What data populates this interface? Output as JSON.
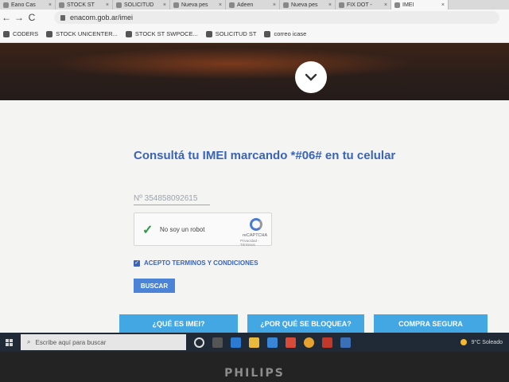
{
  "browser": {
    "tabs": [
      {
        "label": "Eano Cas",
        "active": false
      },
      {
        "label": "STOCK ST",
        "active": false
      },
      {
        "label": "SOLICITUD",
        "active": false
      },
      {
        "label": "Nueva pes",
        "active": false
      },
      {
        "label": "Adeen",
        "active": false
      },
      {
        "label": "Nueva pes",
        "active": false
      },
      {
        "label": "FIX DOT -",
        "active": false
      },
      {
        "label": "IMEI",
        "active": true
      }
    ],
    "url": "enacom.gob.ar/imei",
    "bookmarks": [
      {
        "label": "CODERS"
      },
      {
        "label": "STOCK UNICENTER..."
      },
      {
        "label": "STOCK ST SWPOCE..."
      },
      {
        "label": "SOLICITUD ST"
      },
      {
        "label": "correo icase"
      }
    ]
  },
  "page": {
    "headline": "Consultá tu IMEI marcando *#06# en tu celular",
    "imei_value": "Nº 354858092615",
    "captcha": {
      "label": "No soy un robot",
      "brand": "reCAPTCHA",
      "links": "Privacidad - Términos"
    },
    "terms_label": "ACEPTO TERMINOS Y CONDICIONES",
    "terms_checked": true,
    "search_button": "BUSCAR",
    "bottom_buttons": [
      "¿QUÉ ES IMEI?",
      "¿POR QUÉ SE BLOQUEA?",
      "COMPRA SEGURA"
    ]
  },
  "taskbar": {
    "search_placeholder": "Escribe aquí para buscar",
    "weather": "9°C  Soleado"
  },
  "monitor_brand": "PHILIPS",
  "colors": {
    "accent_blue": "#3a64b6",
    "button_blue": "#4b84d6",
    "bottom_button_blue": "#43a7e3",
    "taskbar": "#1f2a36"
  }
}
